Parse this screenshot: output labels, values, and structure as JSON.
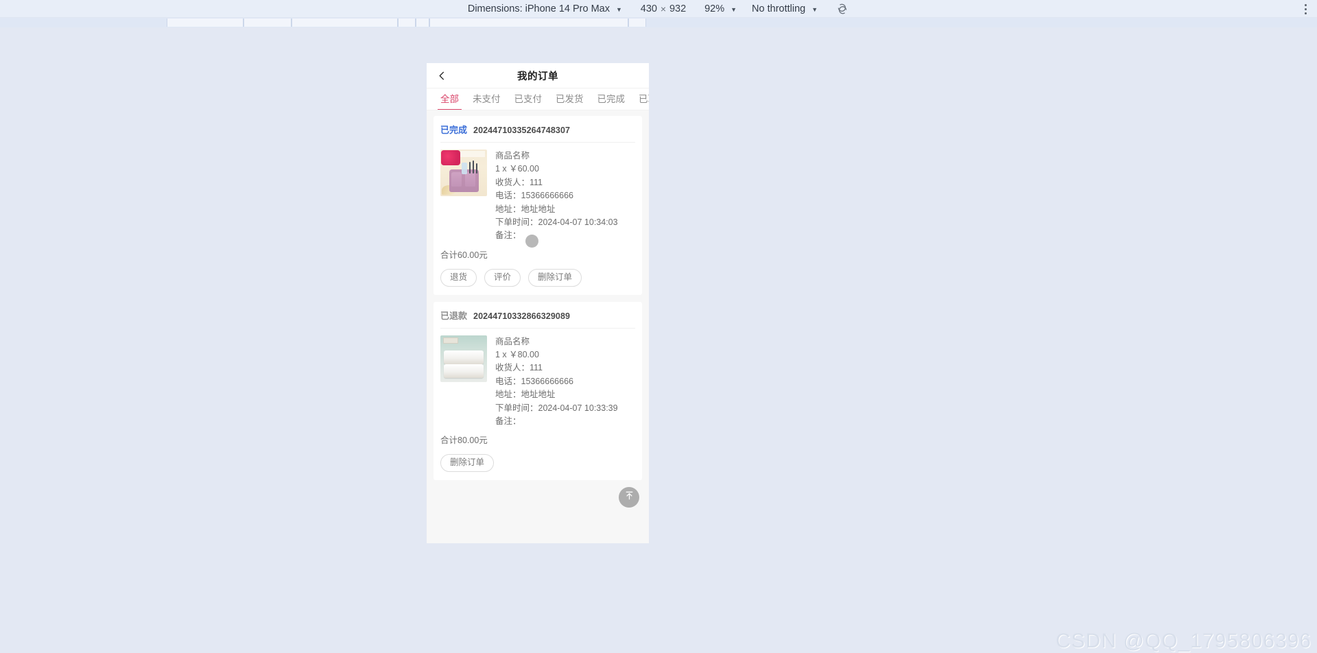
{
  "devtools": {
    "dimensions_label": "Dimensions: iPhone 14 Pro Max",
    "width_value": "430",
    "multiply_symbol": "×",
    "height_value": "932",
    "zoom_value": "92%",
    "throttling_value": "No throttling",
    "rotate_icon": "rotate-icon",
    "kebab_icon": "more-vertical-icon"
  },
  "app": {
    "header": {
      "back_icon": "chevron-left-icon",
      "title": "我的订单"
    },
    "tabs": [
      {
        "label": "全部",
        "active": true
      },
      {
        "label": "未支付",
        "active": false
      },
      {
        "label": "已支付",
        "active": false
      },
      {
        "label": "已发货",
        "active": false
      },
      {
        "label": "已完成",
        "active": false
      },
      {
        "label": "已取消",
        "active": false
      }
    ],
    "orders": [
      {
        "status": "已完成",
        "status_color": "#3c6fd8",
        "order_no": "20244710335264748307",
        "product_name": "商品名称",
        "qty_price": "1 x ￥60.00",
        "receiver": "收货人：111",
        "phone": "电话：15366666666",
        "address": "地址：地址地址",
        "order_time": "下单时间：2024-04-07 10:34:03",
        "remark": "备注：",
        "total": "合计60.00元",
        "actions": [
          "退货",
          "评价",
          "删除订单"
        ]
      },
      {
        "status": "已退款",
        "status_color": "#8e8e8e",
        "order_no": "20244710332866329089",
        "product_name": "商品名称",
        "qty_price": "1 x ￥80.00",
        "receiver": "收货人：111",
        "phone": "电话：15366666666",
        "address": "地址：地址地址",
        "order_time": "下单时间：2024-04-07 10:33:39",
        "remark": "备注：",
        "total": "合计80.00元",
        "actions": [
          "删除订单"
        ]
      }
    ],
    "back_to_top_icon": "arrow-up-to-line-icon"
  },
  "watermark": {
    "text": "CSDN @QQ_1795806396"
  }
}
